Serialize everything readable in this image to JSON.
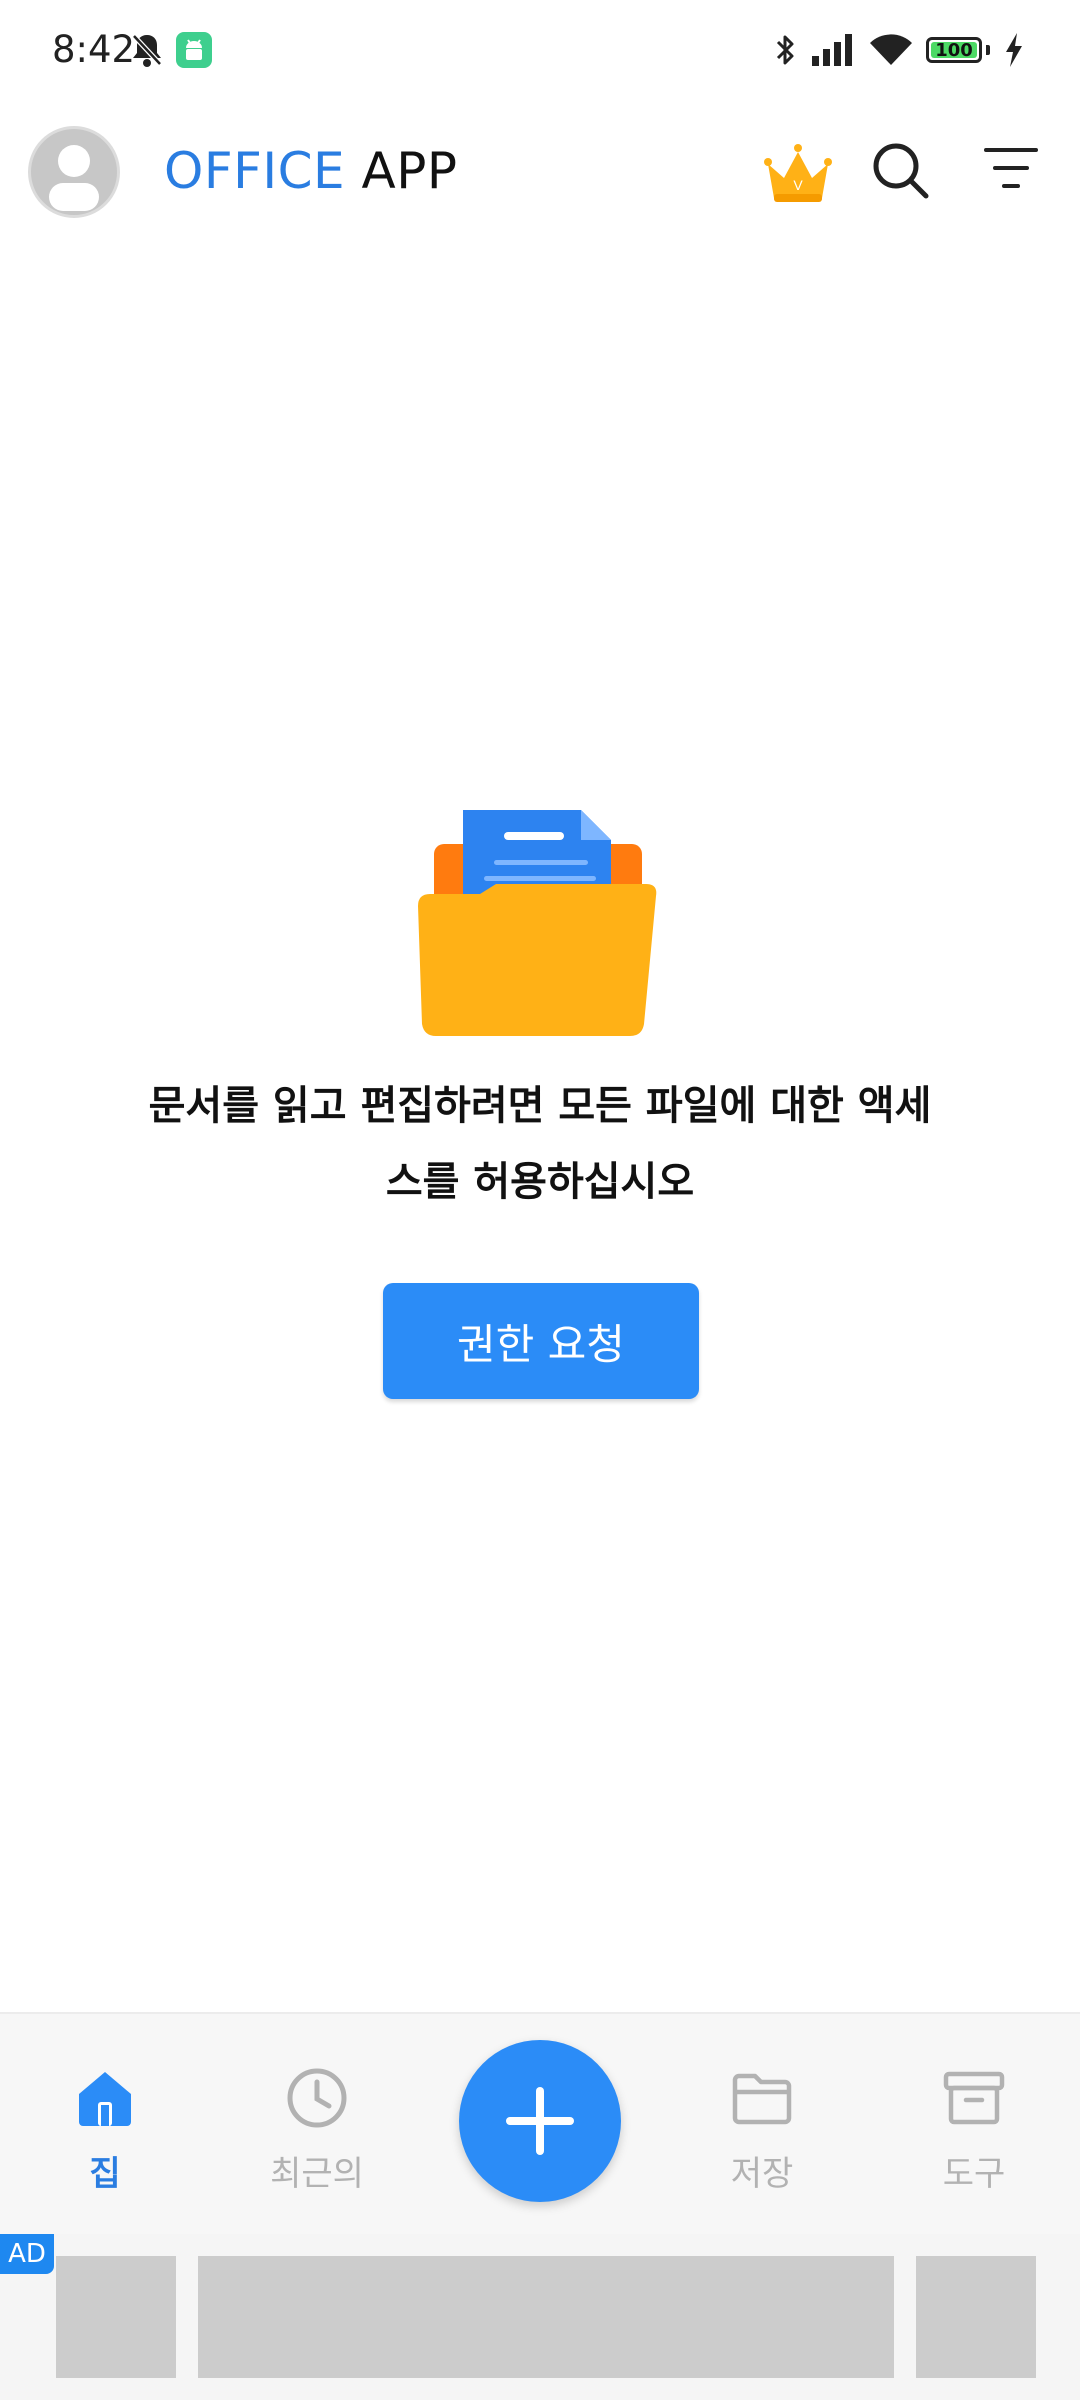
{
  "status_bar": {
    "time": "8:42",
    "battery": "100"
  },
  "app_bar": {
    "title_part1": "OFFICE",
    "title_part2": "APP"
  },
  "empty_state": {
    "message_line1": "문서를 읽고 편집하려면 모든 파일에 대한 액세",
    "message_line2": "스를 허용하십시오",
    "button_label": "권한 요청"
  },
  "bottom_nav": {
    "items": [
      {
        "label": "집",
        "icon": "home-icon",
        "active": true
      },
      {
        "label": "최근의",
        "icon": "clock-icon",
        "active": false
      },
      {
        "label": "저장",
        "icon": "folder-icon",
        "active": false
      },
      {
        "label": "도구",
        "icon": "archive-icon",
        "active": false
      }
    ],
    "fab_icon": "plus-icon"
  },
  "ad": {
    "badge": "AD"
  },
  "colors": {
    "accent": "#2b8cf7",
    "title_blue": "#2a7de1",
    "folder_yellow": "#ffb116",
    "inactive": "#b2b2b2"
  }
}
